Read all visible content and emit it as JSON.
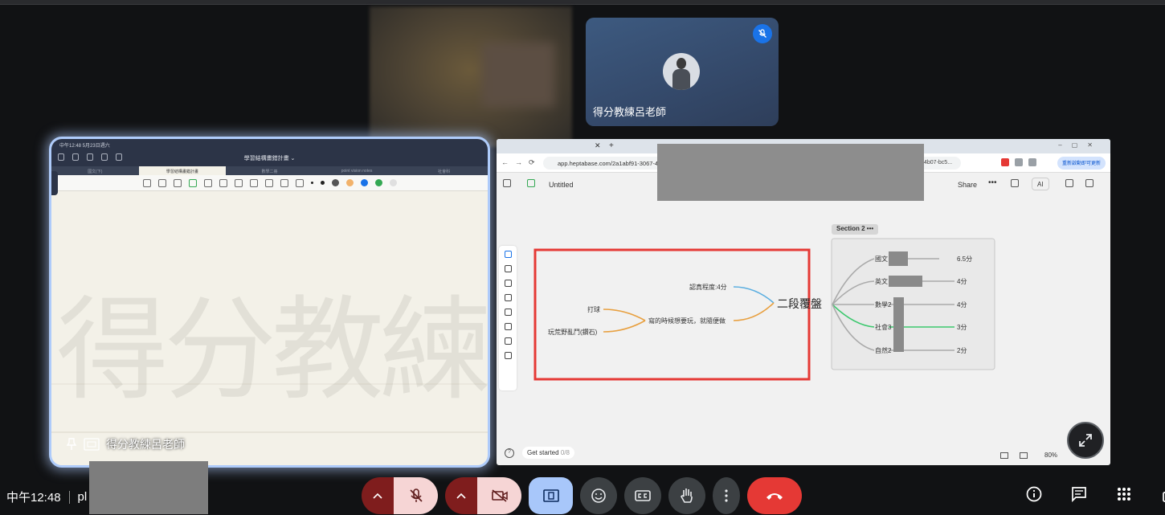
{
  "meeting": {
    "time": "中午12:48",
    "meeting_code_partial": "pl",
    "participants": [
      {
        "name": "得分教練呂老師",
        "muted": true
      }
    ],
    "presenter_label": "得分教練呂老師"
  },
  "ipad_notes": {
    "status_time": "中午12:48  5月23日週六",
    "doc_title": "學習結構畫錯計畫 ⌄",
    "tabs": [
      "國文(下)",
      "學習結構畫錯計畫",
      "數學二冊",
      "point vision notes",
      "社會科"
    ],
    "watermark": "得分教練",
    "pen_colors": [
      "#222222",
      "#555555",
      "#f2b26b",
      "#1a73e8",
      "#34a853",
      "#e0e0e0"
    ]
  },
  "browser": {
    "url": "app.heptabase.com/2a1abf91-3067-4",
    "url_suffix": "4b07-bc5...",
    "update_button": "重新啟動即可更新",
    "doc_title": "Untitled",
    "share": "Share",
    "ai": "AI",
    "get_started": "Get started",
    "get_started_progress": "0/8",
    "zoom": "80%"
  },
  "mindmap_left": {
    "center": "二段覆盤",
    "top_node": "認真程度:4分",
    "mid_node": "寫的時候想要玩，就隨便做",
    "leaf_1": "打球",
    "leaf_2": "玩荒野亂鬥(鑽石)"
  },
  "mindmap_right": {
    "section_title": "Section 2",
    "subjects": [
      "國文",
      "英文",
      "數學2",
      "社會3",
      "自然2"
    ],
    "scores": [
      "6.5分",
      "4分",
      "4分",
      "3分",
      "2分"
    ]
  },
  "colors": {
    "accent_blue": "#1a73e8",
    "hangup_red": "#e53935",
    "highlight_red": "#e53935",
    "branch_orange": "#e8a040",
    "branch_blue": "#5aaee0",
    "branch_green": "#3cc86e"
  }
}
